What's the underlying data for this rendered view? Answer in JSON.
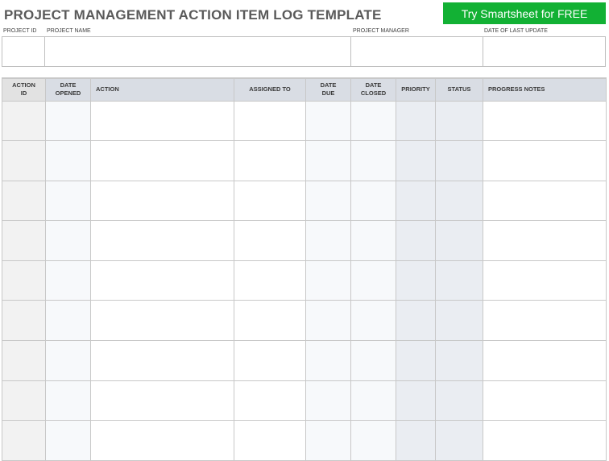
{
  "title": "PROJECT MANAGEMENT ACTION ITEM LOG TEMPLATE",
  "cta": {
    "label": "Try Smartsheet for FREE",
    "color": "#12b134"
  },
  "info_fields": {
    "project_id": {
      "label": "PROJECT ID",
      "value": ""
    },
    "project_name": {
      "label": "PROJECT NAME",
      "value": ""
    },
    "project_manager": {
      "label": "PROJECT MANAGER",
      "value": ""
    },
    "date_of_last_update": {
      "label": "DATE OF LAST UPDATE",
      "value": ""
    }
  },
  "table": {
    "columns": [
      {
        "key": "action_id",
        "label": "ACTION\nID"
      },
      {
        "key": "date_opened",
        "label": "DATE\nOPENED"
      },
      {
        "key": "action",
        "label": "ACTION"
      },
      {
        "key": "assigned_to",
        "label": "ASSIGNED TO"
      },
      {
        "key": "date_due",
        "label": "DATE\nDUE"
      },
      {
        "key": "date_closed",
        "label": "DATE\nCLOSED"
      },
      {
        "key": "priority",
        "label": "PRIORITY"
      },
      {
        "key": "status",
        "label": "STATUS"
      },
      {
        "key": "progress_notes",
        "label": "PROGRESS NOTES"
      }
    ],
    "rows": [
      [
        "",
        "",
        "",
        "",
        "",
        "",
        "",
        "",
        ""
      ],
      [
        "",
        "",
        "",
        "",
        "",
        "",
        "",
        "",
        ""
      ],
      [
        "",
        "",
        "",
        "",
        "",
        "",
        "",
        "",
        ""
      ],
      [
        "",
        "",
        "",
        "",
        "",
        "",
        "",
        "",
        ""
      ],
      [
        "",
        "",
        "",
        "",
        "",
        "",
        "",
        "",
        ""
      ],
      [
        "",
        "",
        "",
        "",
        "",
        "",
        "",
        "",
        ""
      ],
      [
        "",
        "",
        "",
        "",
        "",
        "",
        "",
        "",
        ""
      ],
      [
        "",
        "",
        "",
        "",
        "",
        "",
        "",
        "",
        ""
      ],
      [
        "",
        "",
        "",
        "",
        "",
        "",
        "",
        "",
        ""
      ]
    ]
  }
}
